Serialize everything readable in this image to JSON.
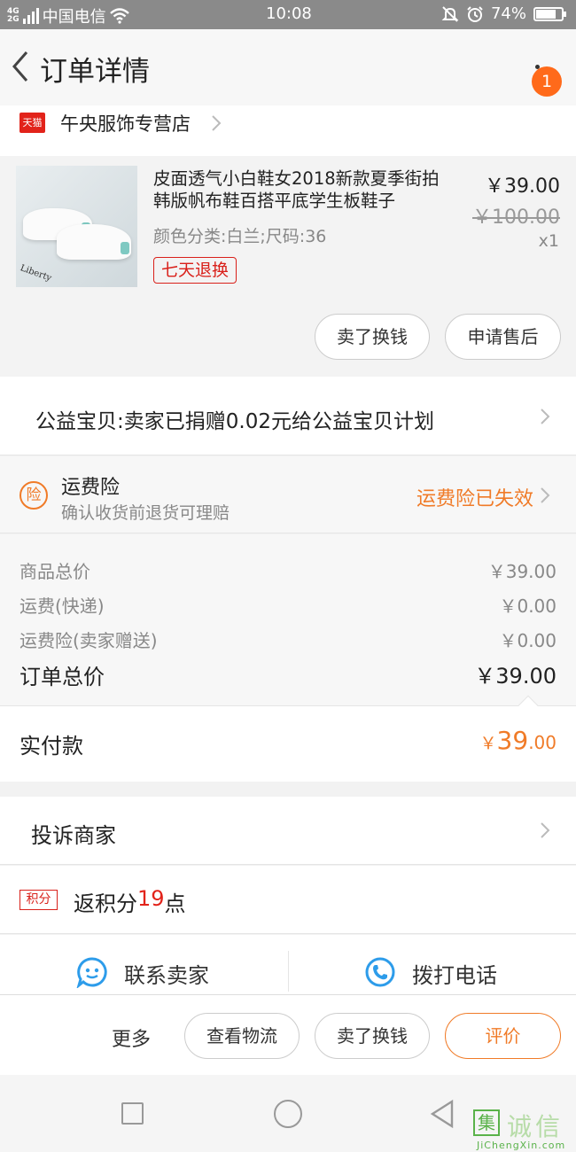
{
  "status_bar": {
    "network_type": "4G",
    "network_type2": "2G",
    "carrier": "中国电信",
    "time": "10:08",
    "battery": "74%"
  },
  "header": {
    "title": "订单详情",
    "badge_count": "1"
  },
  "shop": {
    "logo_text": "天猫",
    "name": "午央服饰专营店"
  },
  "product": {
    "title": "皮面透气小白鞋女2018新款夏季街拍韩版帆布鞋百搭平底学生板鞋子",
    "thumb_text": "Liberty",
    "price": "￥39.00",
    "original_price": "￥100.00",
    "quantity": "x1",
    "sku": "颜色分类:白兰;尺码:36",
    "tag": "七天退换",
    "buttons": {
      "resell": "卖了换钱",
      "after_sale": "申请售后"
    }
  },
  "charity": {
    "text": "公益宝贝:卖家已捐赠0.02元给公益宝贝计划"
  },
  "insurance": {
    "icon_text": "险",
    "title": "运费险",
    "subtitle": "确认收货前退货可理赔",
    "status": "运费险已失效"
  },
  "pricing": {
    "items": [
      {
        "label": "商品总价",
        "value": "￥39.00"
      },
      {
        "label": "运费(快递)",
        "value": "￥0.00"
      },
      {
        "label": "运费险(卖家赠送)",
        "value": "￥0.00"
      }
    ],
    "total_label": "订单总价",
    "total_value": "￥39.00",
    "paid_label": "实付款",
    "paid_currency": "￥",
    "paid_integer": "39",
    "paid_decimal": ".00"
  },
  "complaint": {
    "label": "投诉商家"
  },
  "points": {
    "icon_text": "积分",
    "prefix": "返积分",
    "number": "19",
    "suffix": "点"
  },
  "contact": {
    "seller": "联系卖家",
    "phone": "拨打电话"
  },
  "actions": {
    "more": "更多",
    "logistics": "查看物流",
    "resell": "卖了换钱",
    "review": "评价"
  },
  "watermark": {
    "mark": "集",
    "text": "诚信",
    "url": "JiChengXin.com"
  },
  "colors": {
    "accent_orange": "#f07b28",
    "tmall_red": "#e2231a",
    "badge_orange": "#ff6a1a"
  }
}
